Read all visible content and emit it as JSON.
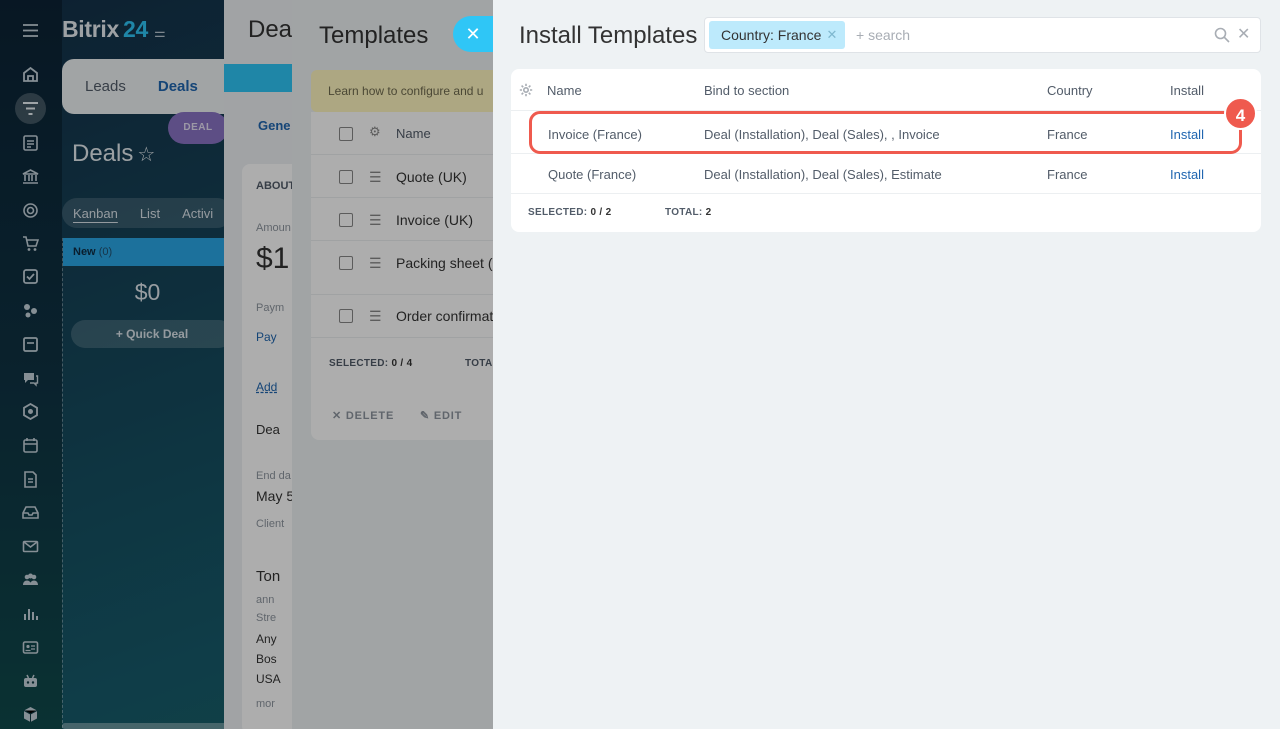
{
  "app": {
    "logo_name": "Bitrix",
    "logo_number": "24",
    "top_tabs": [
      "Leads",
      "Deals"
    ],
    "deal_pill": "DEAL",
    "title": "Deals",
    "view_tabs": [
      "Kanban",
      "List",
      "Activi"
    ],
    "kanban": {
      "stage": "New",
      "count": "(0)",
      "sum": "$0",
      "quick_deal": "Quick Deal"
    },
    "rail_icons": [
      "menu-icon",
      "home-icon",
      "funnel-icon",
      "clipboard-icon",
      "bank-icon",
      "target-icon",
      "cart-icon",
      "checkbox-icon",
      "crm-icon",
      "book-icon",
      "chat-icon",
      "hexagon-icon",
      "calendar-icon",
      "document-icon",
      "inbox-icon",
      "mail-icon",
      "users-icon",
      "chart-icon",
      "contact-card-icon",
      "robot-icon",
      "box-icon"
    ]
  },
  "deal_detail": {
    "title": "Dea",
    "tab_general": "Gene",
    "about": "ABOUT",
    "amount_label": "Amoun",
    "amount_value": "$1,",
    "end_date_label": "End da",
    "end_date_value": "May 5",
    "client_label": "Client",
    "payment_label": "Paym",
    "payment_link": "Pay",
    "add_link": "Add",
    "deal_text": "Dea",
    "contact_name": "Ton",
    "contact_lines": [
      "ann",
      "Stre",
      "Any",
      "Bos",
      "USA",
      "mor"
    ]
  },
  "templates": {
    "title": "Templates",
    "hint": "Learn how to configure and u",
    "header_name": "Name",
    "rows": [
      "Quote (UK)",
      "Invoice (UK)",
      "Packing sheet (U",
      "Order confirmat"
    ],
    "selected_label": "SELECTED:",
    "selected_value": "0 / 4",
    "total_label": "TOTA",
    "delete_label": "DELETE",
    "edit_label": "EDIT"
  },
  "install": {
    "title": "Install Templates",
    "filter_chip": "Country: France",
    "search_placeholder": "+ search",
    "columns": {
      "name": "Name",
      "section": "Bind to section",
      "country": "Country",
      "install": "Install"
    },
    "rows": [
      {
        "name": "Invoice (France)",
        "section": "Deal (Installation), Deal (Sales), , Invoice",
        "country": "France",
        "action": "Install"
      },
      {
        "name": "Quote (France)",
        "section": "Deal (Installation), Deal (Sales), Estimate",
        "country": "France",
        "action": "Install"
      }
    ],
    "selected_label": "SELECTED:",
    "selected_value": "0 / 2",
    "total_label": "TOTAL:",
    "total_value": "2",
    "step_badge": "4"
  },
  "colors": {
    "accent": "#2fc6f6",
    "link": "#2066b0",
    "highlight": "#ef5a4e",
    "chip": "#bdeafc"
  }
}
